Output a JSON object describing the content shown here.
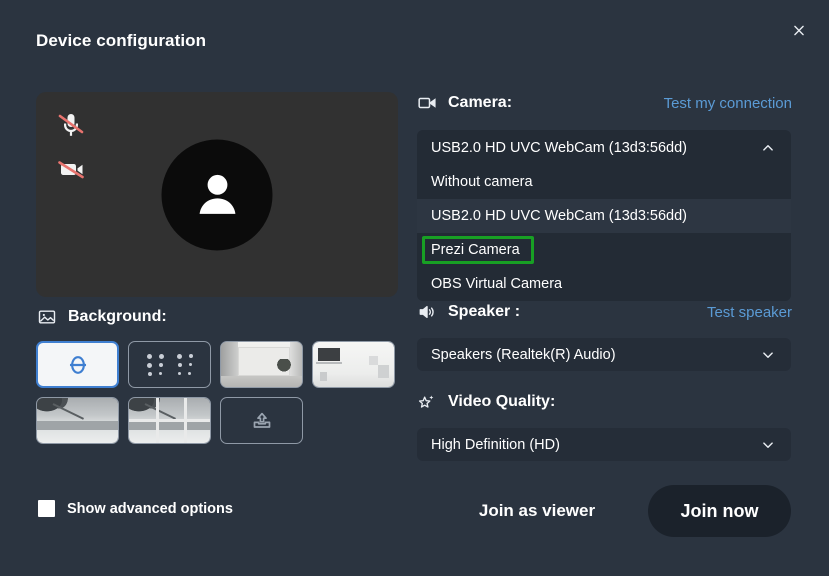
{
  "dialog": {
    "title": "Device configuration",
    "close_icon": "close-icon"
  },
  "preview": {
    "mic_status_icon": "microphone-muted-icon",
    "camera_status_icon": "camera-off-icon",
    "avatar_icon": "person-avatar-icon"
  },
  "background": {
    "icon": "image-icon",
    "label": "Background:",
    "thumbnails": [
      {
        "name": "none-background",
        "kind": "none",
        "selected": true
      },
      {
        "name": "blur-background",
        "kind": "blur",
        "selected": false
      },
      {
        "name": "room-background",
        "kind": "room",
        "selected": false
      },
      {
        "name": "office-background",
        "kind": "office",
        "selected": false
      },
      {
        "name": "beach-background",
        "kind": "beach",
        "selected": false
      },
      {
        "name": "beach-window-background",
        "kind": "beach-window",
        "selected": false
      },
      {
        "name": "upload-background",
        "kind": "upload",
        "selected": false
      }
    ]
  },
  "advanced": {
    "label": "Show advanced options",
    "checked": false
  },
  "camera": {
    "icon": "video-camera-icon",
    "label": "Camera:",
    "test_link": "Test my connection",
    "selected": "USB2.0 HD UVC WebCam (13d3:56dd)",
    "chevron": "chevron-up-icon",
    "expanded": true,
    "options": [
      {
        "label": "Without camera",
        "active": false,
        "highlighted": false
      },
      {
        "label": "USB2.0 HD UVC WebCam (13d3:56dd)",
        "active": true,
        "highlighted": false
      },
      {
        "label": "Prezi Camera",
        "active": false,
        "highlighted": true
      },
      {
        "label": "OBS Virtual Camera",
        "active": false,
        "highlighted": false
      }
    ]
  },
  "speaker": {
    "icon": "speaker-icon",
    "label": "Speaker :",
    "test_link": "Test speaker",
    "selected": "Speakers (Realtek(R) Audio)",
    "chevron": "chevron-down-icon"
  },
  "video_quality": {
    "icon": "sparkle-star-icon",
    "label": "Video Quality:",
    "selected": "High Definition (HD)",
    "chevron": "chevron-down-icon"
  },
  "actions": {
    "join_viewer": "Join as viewer",
    "join_now": "Join now"
  },
  "colors": {
    "dialog_bg": "#2b3440",
    "select_bg": "#232b35",
    "option_active_bg": "#2d3642",
    "link_blue": "#5b9bd5",
    "highlight_green": "#18a024",
    "primary_button_bg": "#1b222b",
    "selected_thumb_border": "#3f7fd1",
    "mute_red": "#e06666"
  }
}
